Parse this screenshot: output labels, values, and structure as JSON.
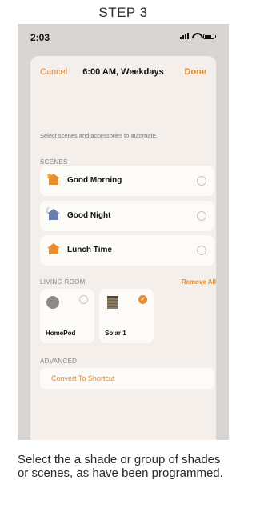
{
  "step_title": "STEP 3",
  "status_bar": {
    "time": "2:03"
  },
  "nav": {
    "cancel": "Cancel",
    "title": "6:00 AM, Weekdays",
    "done": "Done"
  },
  "hint": "Select scenes and accessories to automate.",
  "scenes": {
    "section_label": "SCENES",
    "items": [
      {
        "label": "Good Morning",
        "icon": "sun-house-icon"
      },
      {
        "label": "Good Night",
        "icon": "moon-house-icon"
      },
      {
        "label": "Lunch Time",
        "icon": "house-icon"
      }
    ]
  },
  "room": {
    "section_label": "LIVING ROOM",
    "remove_all": "Remove All",
    "accessories": [
      {
        "label": "HomePod",
        "selected": false
      },
      {
        "label": "Solar 1",
        "selected": true
      }
    ]
  },
  "advanced": {
    "section_label": "ADVANCED",
    "shortcut_label": "Convert To Shortcut"
  },
  "caption": "Select the  a shade or group of shades or scenes, as have been programmed.",
  "colors": {
    "accent": "#e08a2b",
    "sheet_bg": "#f4efea",
    "card_bg": "#fdfbf8"
  }
}
